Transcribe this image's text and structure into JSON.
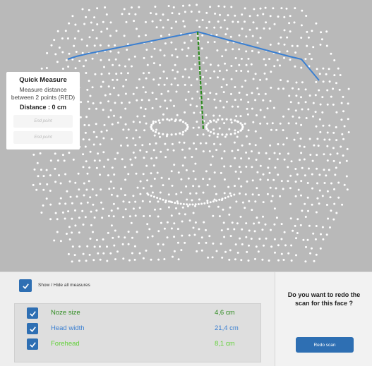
{
  "quick_measure": {
    "title": "Quick Measure",
    "description": "Measure distance between 2 points (RED)",
    "distance": "Distance : 0 cm",
    "end_point_1": "End point",
    "end_point_2": "End point"
  },
  "toggle": {
    "label": "Show / Hide all measures",
    "checked": true
  },
  "measures": [
    {
      "name": "Noze size",
      "value": "4,6 cm",
      "color": "#2e8b1f",
      "checked": true
    },
    {
      "name": "Head width",
      "value": "21,4 cm",
      "color": "#3a7fd1",
      "checked": true
    },
    {
      "name": "Forehead",
      "value": "8,1 cm",
      "color": "#63d13a",
      "checked": true
    }
  ],
  "redo": {
    "question": "Do you want to redo the scan for this face ?",
    "button": "Redo scan"
  },
  "colors": {
    "accent": "#2e6fb3",
    "head_line": "#3a7fd1",
    "nose_line": "#2e8b1f",
    "background": "#b9b9b9"
  }
}
